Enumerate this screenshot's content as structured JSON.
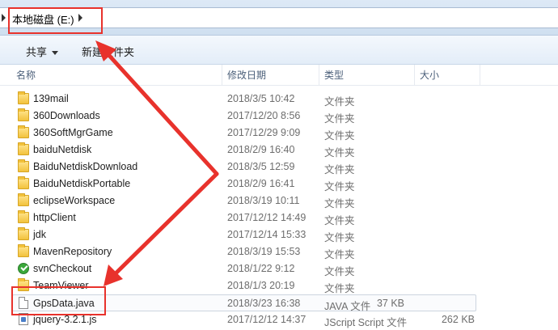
{
  "address": {
    "crumb": "本地磁盘 (E:)",
    "faded_text": "— — — — — — — —"
  },
  "toolbar": {
    "share_label": "共享",
    "new_folder_label": "新建文件夹"
  },
  "columns": {
    "name": "名称",
    "modified": "修改日期",
    "type": "类型",
    "size": "大小"
  },
  "files": [
    {
      "name": "139mail",
      "date": "2018/3/5 10:42",
      "type": "文件夹",
      "size": "",
      "icon": "folder-icon"
    },
    {
      "name": "360Downloads",
      "date": "2017/12/20 8:56",
      "type": "文件夹",
      "size": "",
      "icon": "folder-icon"
    },
    {
      "name": "360SoftMgrGame",
      "date": "2017/12/29 9:09",
      "type": "文件夹",
      "size": "",
      "icon": "folder-icon"
    },
    {
      "name": "baiduNetdisk",
      "date": "2018/2/9 16:40",
      "type": "文件夹",
      "size": "",
      "icon": "folder-icon"
    },
    {
      "name": "BaiduNetdiskDownload",
      "date": "2018/3/5 12:59",
      "type": "文件夹",
      "size": "",
      "icon": "folder-icon"
    },
    {
      "name": "BaiduNetdiskPortable",
      "date": "2018/2/9 16:41",
      "type": "文件夹",
      "size": "",
      "icon": "folder-icon"
    },
    {
      "name": "eclipseWorkspace",
      "date": "2018/3/19 10:11",
      "type": "文件夹",
      "size": "",
      "icon": "folder-icon"
    },
    {
      "name": "httpClient",
      "date": "2017/12/12 14:49",
      "type": "文件夹",
      "size": "",
      "icon": "folder-icon"
    },
    {
      "name": "jdk",
      "date": "2017/12/14 15:33",
      "type": "文件夹",
      "size": "",
      "icon": "folder-icon"
    },
    {
      "name": "MavenRepository",
      "date": "2018/3/19 15:53",
      "type": "文件夹",
      "size": "",
      "icon": "folder-icon"
    },
    {
      "name": "svnCheckout",
      "date": "2018/1/22 9:12",
      "type": "文件夹",
      "size": "",
      "icon": "svn-check-icon"
    },
    {
      "name": "TeamViewer",
      "date": "2018/1/3 20:19",
      "type": "文件夹",
      "size": "",
      "icon": "folder-icon"
    },
    {
      "name": "GpsData.java",
      "date": "2018/3/23 16:38",
      "type": "JAVA 文件",
      "size": "37 KB",
      "icon": "java-file-icon"
    },
    {
      "name": "jquery-3.2.1.js",
      "date": "2017/12/12 14:37",
      "type": "JScript Script 文件",
      "size": "262 KB",
      "icon": "script-file-icon"
    }
  ],
  "colors": {
    "annotation": "#e8322c",
    "folder": "#f2c23c"
  }
}
